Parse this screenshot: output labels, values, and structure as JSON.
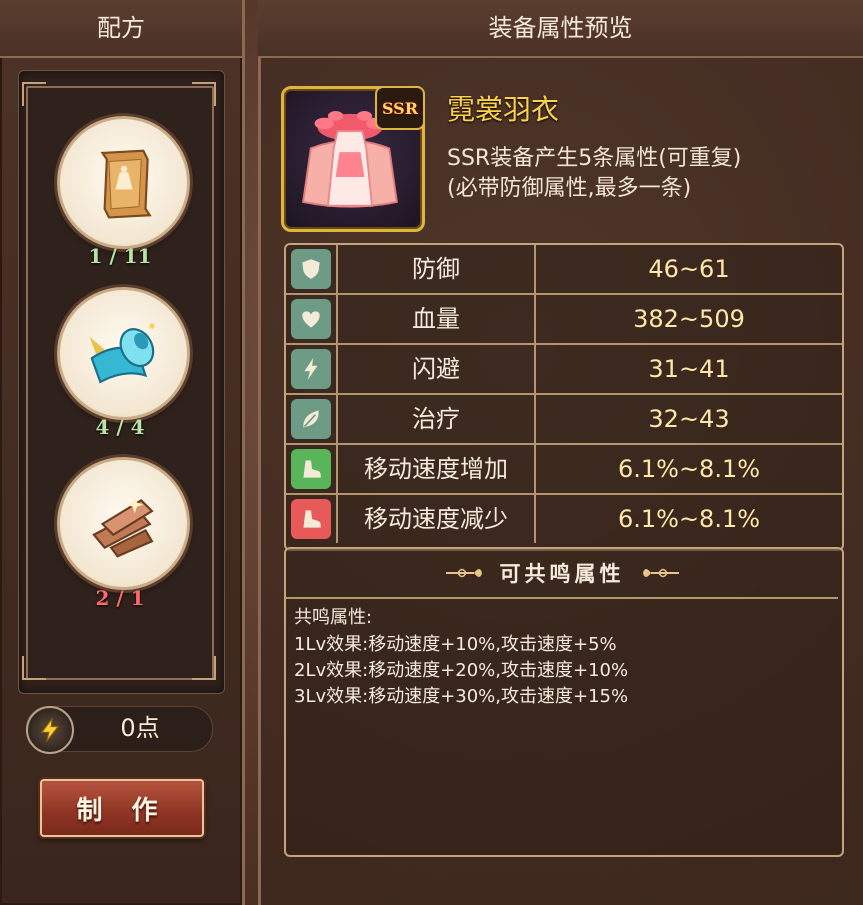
{
  "recipe_panel": {
    "title": "配方",
    "materials": [
      {
        "icon": "scroll-icon",
        "count": "1 / 11",
        "count_color": "#b9e3a6"
      },
      {
        "icon": "cloth-roll-icon",
        "count": "4 / 4",
        "count_color": "#b9e3a6"
      },
      {
        "icon": "wood-planks-icon",
        "count": "2 / 1",
        "count_color": "#ff6a6a"
      }
    ],
    "points": "0点",
    "craft_button": "制 作"
  },
  "preview_panel": {
    "title": "装备属性预览",
    "item": {
      "name": "霓裳羽衣",
      "rarity": "SSR",
      "desc_line1": "SSR装备产生5条属性(可重复)",
      "desc_line2": "(必带防御属性,最多一条)"
    },
    "stats": [
      {
        "icon": "shield-icon",
        "name": "防御",
        "value": "46~61",
        "icon_color": "#6e9b86"
      },
      {
        "icon": "heart-icon",
        "name": "血量",
        "value": "382~509",
        "icon_color": "#6e9b86"
      },
      {
        "icon": "lightning-icon",
        "name": "闪避",
        "value": "31~41",
        "icon_color": "#6e9b86"
      },
      {
        "icon": "leaf-icon",
        "name": "治疗",
        "value": "32~43",
        "icon_color": "#6e9b86"
      },
      {
        "icon": "boot-up-icon",
        "name": "移动速度增加",
        "value": "6.1%~8.1%",
        "icon_color": "#59b45a"
      },
      {
        "icon": "boot-down-icon",
        "name": "移动速度减少",
        "value": "6.1%~8.1%",
        "icon_color": "#e85a5a"
      }
    ],
    "resonance": {
      "title": "可共鸣属性",
      "lines": [
        "共鸣属性:",
        "1Lv效果:移动速度+10%,攻击速度+5%",
        "2Lv效果:移动速度+20%,攻击速度+10%",
        "3Lv效果:移动速度+30%,攻击速度+15%"
      ]
    }
  }
}
